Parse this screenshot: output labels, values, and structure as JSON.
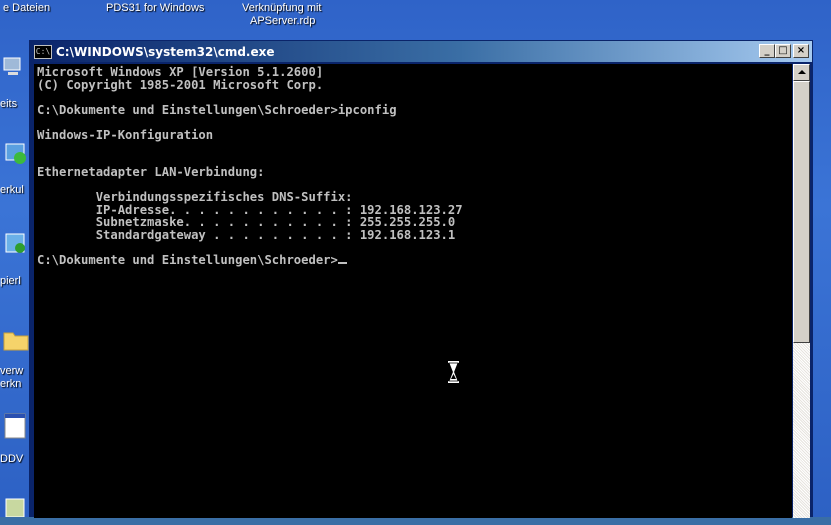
{
  "desktop": {
    "top_labels": [
      "e Dateien",
      "PDS31 for Windows",
      "Verknüpfung mit",
      "APServer.rdp"
    ],
    "side_labels": [
      "eits",
      "erkul",
      "pierl",
      "verw",
      "erkn",
      "DDV"
    ]
  },
  "window": {
    "title": "C:\\WINDOWS\\system32\\cmd.exe",
    "icon_text": "C:\\",
    "controls": {
      "minimize": "_",
      "maximize": "□",
      "close": "×"
    }
  },
  "console": {
    "lines": [
      "Microsoft Windows XP [Version 5.1.2600]",
      "(C) Copyright 1985-2001 Microsoft Corp.",
      "",
      "C:\\Dokumente und Einstellungen\\Schroeder>ipconfig",
      "",
      "Windows-IP-Konfiguration",
      "",
      "",
      "Ethernetadapter LAN-Verbindung:",
      "",
      "        Verbindungsspezifisches DNS-Suffix:",
      "        IP-Adresse. . . . . . . . . . . . : 192.168.123.27",
      "        Subnetzmaske. . . . . . . . . . . : 255.255.255.0",
      "        Standardgateway . . . . . . . . . : 192.168.123.1",
      "",
      "C:\\Dokumente und Einstellungen\\Schroeder>"
    ]
  },
  "colors": {
    "console_bg": "#000000",
    "console_fg": "#c0c0c0",
    "titlebar_start": "#0a246a",
    "titlebar_end": "#a6caf0"
  }
}
